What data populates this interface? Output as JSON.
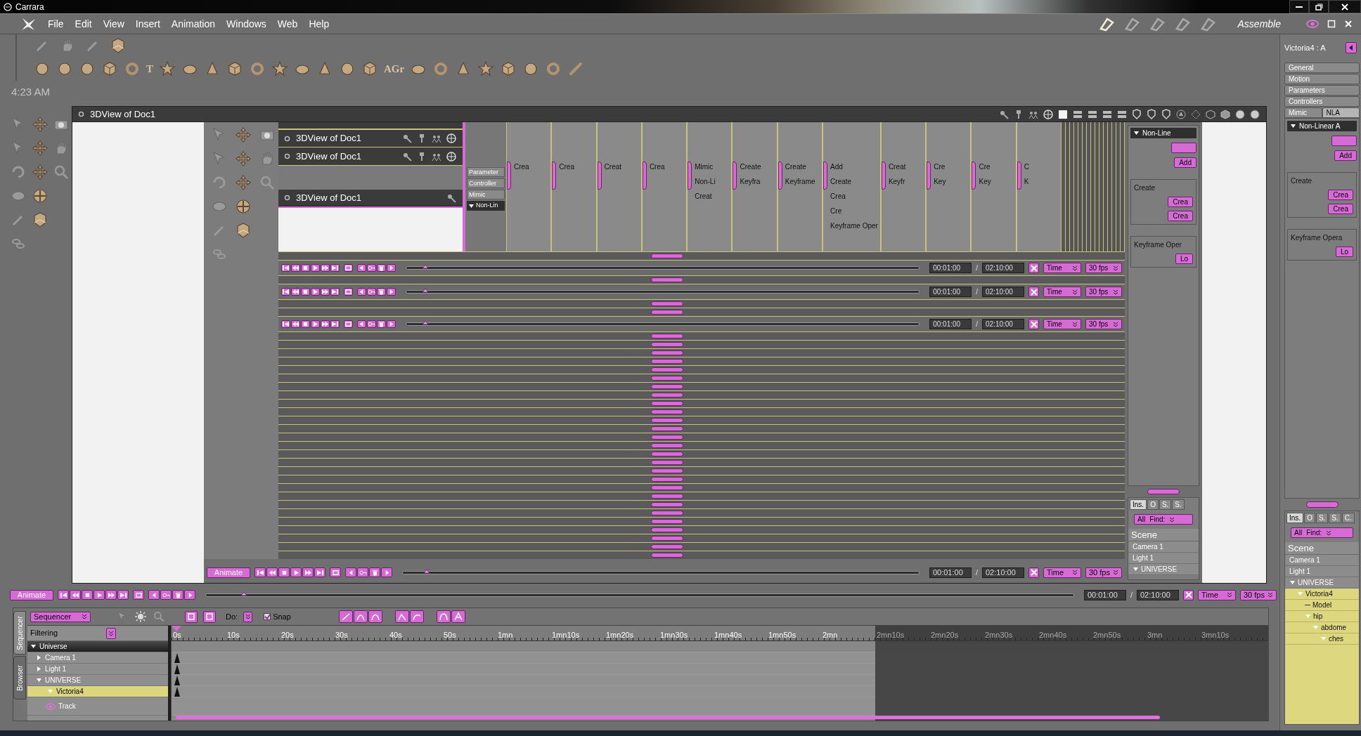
{
  "window": {
    "title": "Carrara"
  },
  "menu": [
    "File",
    "Edit",
    "View",
    "Insert",
    "Animation",
    "Windows",
    "Web",
    "Help"
  ],
  "room": {
    "label": "Assemble"
  },
  "toolbar_glyphs": [
    "T",
    "AGr"
  ],
  "clock": "4:23 AM",
  "view": {
    "title": "3DView of Doc1",
    "nested_titles": [
      "3DView of Doc1",
      "3DView of Doc1",
      "3DView of Doc1"
    ],
    "inner_tabs": [
      "Parameter",
      "Controller",
      "Mimic"
    ],
    "inner_section": "Non-Lin",
    "inner_columns": [
      {
        "texts": [
          "Crea"
        ]
      },
      {
        "texts": [
          "Crea"
        ]
      },
      {
        "texts": [
          "Creat"
        ]
      },
      {
        "texts": [
          "Crea"
        ]
      },
      {
        "texts": [
          "Mimic",
          "Non-Li",
          "Creat"
        ]
      },
      {
        "texts": [
          "Create",
          "Keyfra"
        ]
      },
      {
        "texts": [
          "Create",
          "Keyframe"
        ]
      },
      {
        "texts": [
          "Add",
          "Create",
          "Crea",
          "Cre",
          "Keyframe Oper"
        ]
      },
      {
        "texts": [
          "Creat",
          "Keyfr"
        ]
      },
      {
        "texts": [
          "Cre",
          "Key"
        ]
      },
      {
        "texts": [
          "Cre",
          "Key"
        ]
      },
      {
        "texts": [
          "C",
          "K"
        ]
      }
    ],
    "inner_transports": [
      {
        "start": "00:01:00",
        "sep": "/",
        "end": "02:10:00",
        "unit": "Time",
        "fps": "30 fps",
        "level": 0.03
      },
      {
        "start": "00:01:00",
        "sep": "/",
        "end": "02:10:00",
        "unit": "Time",
        "fps": "30 fps",
        "level": 0.03
      },
      {
        "start": "00:01:00",
        "sep": "/",
        "end": "02:10:00",
        "unit": "Time",
        "fps": "30 fps",
        "level": 0.03
      }
    ],
    "transport": {
      "animate": "Animate",
      "start": "00:01:00",
      "sep": "/",
      "end": "02:10:00",
      "unit": "Time",
      "fps": "30 fps",
      "level": 0.04
    },
    "inner_panel": {
      "section": "Non-Line",
      "buttons": [
        "Add"
      ],
      "groups": [
        {
          "title": "Create",
          "buttons": [
            "Crea",
            "Crea"
          ]
        },
        {
          "title": "Keyframe Oper",
          "buttons": [
            "Lo"
          ]
        }
      ],
      "browser_tabs": [
        {
          "label": "Ins.",
          "selected": true
        },
        {
          "label": "O",
          "selected": false
        },
        {
          "label": "S.",
          "selected": false
        },
        {
          "label": "S.",
          "selected": false
        }
      ],
      "filter": "All",
      "find": "Find:",
      "scene": "Scene",
      "tree": [
        {
          "label": "Camera 1"
        },
        {
          "label": "Light 1"
        },
        {
          "label": "UNIVERSE",
          "expanded": true
        }
      ]
    }
  },
  "transport": {
    "animate": "Animate",
    "start": "00:01:00",
    "sep": "/",
    "end": "02:10:00",
    "unit": "Time",
    "fps": "30 fps",
    "level": 0.04
  },
  "sequencer": {
    "side_tabs": [
      {
        "label": "Sequencer",
        "selected": true
      },
      {
        "label": "Browser",
        "selected": false
      }
    ],
    "mode": "Sequencer",
    "do": "Do:",
    "snap": {
      "label": "Snap",
      "checked": true
    },
    "filtering": "Filtering",
    "tracks": [
      {
        "label": "Universe",
        "kind": "header",
        "expanded": true,
        "selected": false,
        "keyframe": false
      },
      {
        "label": "Camera 1",
        "kind": "object",
        "expanded": false,
        "selected": false,
        "keyframe": true
      },
      {
        "label": "Light 1",
        "kind": "object",
        "expanded": false,
        "selected": false,
        "keyframe": true
      },
      {
        "label": "UNIVERSE",
        "kind": "object",
        "expanded": true,
        "selected": false,
        "keyframe": true
      },
      {
        "label": "Victoria4",
        "kind": "object",
        "expanded": true,
        "selected": true,
        "keyframe": true
      },
      {
        "label": "Track",
        "kind": "track",
        "selected": false,
        "keyframe": false
      }
    ],
    "ruler": [
      {
        "label": "0s",
        "dimmed": false
      },
      {
        "label": "10s",
        "dimmed": false
      },
      {
        "label": "20s",
        "dimmed": false
      },
      {
        "label": "30s",
        "dimmed": false
      },
      {
        "label": "40s",
        "dimmed": false
      },
      {
        "label": "50s",
        "dimmed": false
      },
      {
        "label": "1mn",
        "dimmed": false
      },
      {
        "label": "1mn10s",
        "dimmed": false
      },
      {
        "label": "1mn20s",
        "dimmed": false
      },
      {
        "label": "1mn30s",
        "dimmed": false
      },
      {
        "label": "1mn40s",
        "dimmed": false
      },
      {
        "label": "1mn50s",
        "dimmed": false
      },
      {
        "label": "2mn",
        "dimmed": false
      },
      {
        "label": "2mn10s",
        "dimmed": true
      },
      {
        "label": "2mn20s",
        "dimmed": true
      },
      {
        "label": "2mn30s",
        "dimmed": true
      },
      {
        "label": "2mn40s",
        "dimmed": true
      },
      {
        "label": "2mn50s",
        "dimmed": true
      },
      {
        "label": "3mn",
        "dimmed": true
      },
      {
        "label": "3mn10s",
        "dimmed": true
      }
    ]
  },
  "properties": {
    "object": "Victoria4 : A",
    "tabs": [
      {
        "label": "General",
        "selected": false
      },
      {
        "label": "Motion",
        "selected": false
      },
      {
        "label": "Parameters",
        "selected": false
      },
      {
        "label": "Controllers",
        "selected": false
      },
      {
        "label": "Mimic",
        "selected": false
      },
      {
        "label": "NLA",
        "selected": true
      }
    ],
    "section": "Non-Linear A",
    "buttons": [
      "Add"
    ],
    "groups": [
      {
        "title": "Create",
        "buttons": [
          "Crea",
          "Crea"
        ]
      },
      {
        "title": "Keyframe Opera",
        "buttons": [
          "Lo"
        ]
      }
    ],
    "browser_tabs": [
      {
        "label": "Ins.",
        "selected": true
      },
      {
        "label": "O",
        "selected": false
      },
      {
        "label": "S.",
        "selected": false
      },
      {
        "label": "S.",
        "selected": false
      },
      {
        "label": "C.",
        "selected": false
      }
    ],
    "filter": "All",
    "find": "Find:",
    "scene": "Scene",
    "tree": [
      {
        "label": "Camera 1"
      },
      {
        "label": "Light 1"
      },
      {
        "label": "UNIVERSE",
        "expanded": true,
        "children": [
          {
            "label": "Victoria4",
            "expanded": true,
            "children": [
              {
                "label": "Model"
              },
              {
                "label": "hip",
                "expanded": true,
                "children": [
                  {
                    "label": "abdome",
                    "expanded": true,
                    "children": [
                      {
                        "label": "ches",
                        "expanded": true
                      }
                    ]
                  }
                ]
              }
            ]
          }
        ]
      }
    ]
  }
}
